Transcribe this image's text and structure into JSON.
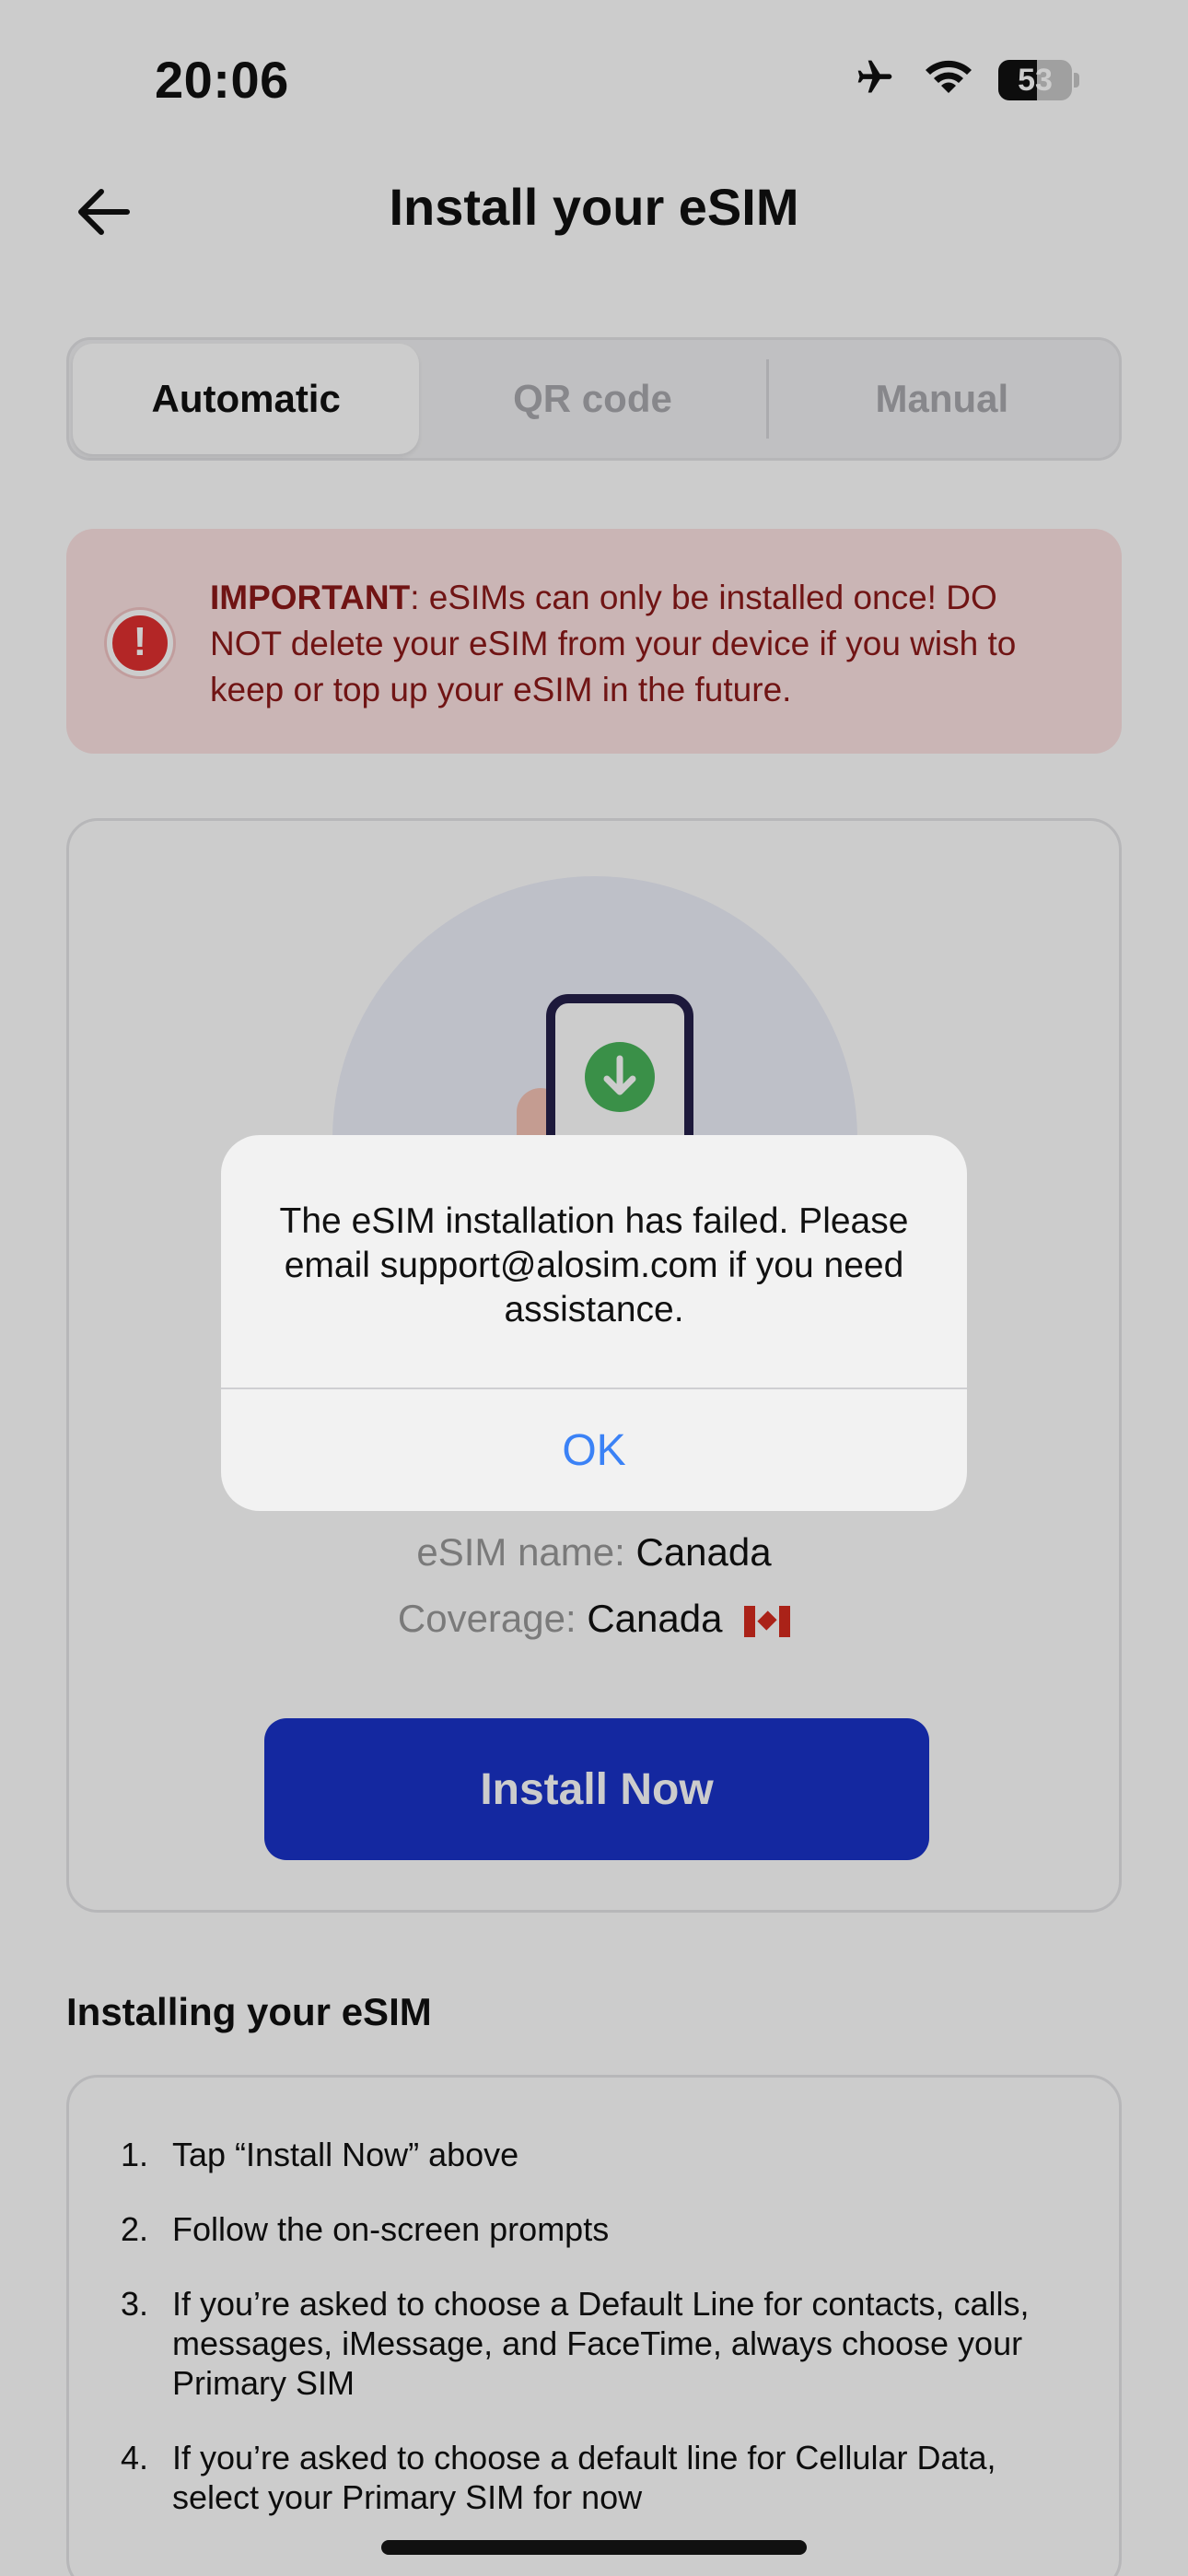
{
  "status_bar": {
    "time": "20:06",
    "battery_level": "53",
    "battery_fraction": 0.53,
    "icons": [
      "airplane-icon",
      "wifi-icon",
      "battery-icon"
    ]
  },
  "header": {
    "title": "Install your eSIM",
    "back_icon": "arrow-left-icon"
  },
  "tabs": [
    {
      "label": "Automatic",
      "active": true
    },
    {
      "label": "QR code",
      "active": false
    },
    {
      "label": "Manual",
      "active": false
    }
  ],
  "important": {
    "label": "IMPORTANT",
    "text": ": eSIMs can only be installed once! DO NOT delete your eSIM from your device if you wish to keep or top up your eSIM in the future.",
    "icon": "exclamation-icon"
  },
  "esim": {
    "name_label": "eSIM name:",
    "name_value": "Canada",
    "coverage_label": "Coverage:",
    "coverage_value": "Canada",
    "flag": "canada-flag-icon"
  },
  "install_button": "Install Now",
  "steps_section": {
    "title": "Installing your eSIM",
    "steps": [
      {
        "num": "1.",
        "text": "Tap “Install Now” above"
      },
      {
        "num": "2.",
        "text": "Follow the on-screen prompts"
      },
      {
        "num": "3.",
        "text": "If you’re asked to choose a Default Line for contacts, calls, messages, iMessage, and FaceTime, always choose your Primary SIM"
      },
      {
        "num": "4.",
        "text": "If you’re asked to choose a default line for Cellular Data, select your Primary SIM for now"
      }
    ]
  },
  "alert": {
    "message": "The eSIM installation has failed. Please email support@alosim.com if you need assistance.",
    "ok_label": "OK"
  },
  "colors": {
    "primary_button": "#1a33c8",
    "alert_link": "#3b82f6",
    "warning_bg": "#fde3e3",
    "warning_text": "#8c1a1a"
  }
}
